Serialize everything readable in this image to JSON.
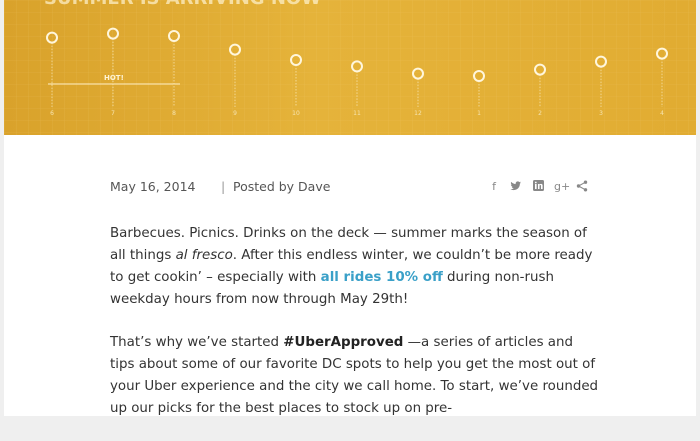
{
  "hero": {
    "title": "SUMMER IS ARRIVING NOW",
    "hot_label": "HOT!",
    "times": [
      "6",
      "7",
      "8",
      "9",
      "10",
      "11",
      "12",
      "1",
      "2",
      "3",
      "4"
    ],
    "temps": [
      0.78,
      0.83,
      0.8,
      0.63,
      0.5,
      0.42,
      0.33,
      0.3,
      0.38,
      0.48,
      0.58
    ]
  },
  "post": {
    "date": "May 16, 2014",
    "separator": "|",
    "posted_by": "Posted by Dave",
    "share_icons": [
      "facebook-icon",
      "twitter-icon",
      "linkedin-icon",
      "google-plus-icon",
      "share-icon"
    ],
    "p1_a": "Barbecues. Picnics. Drinks on the deck — summer marks the season of all things ",
    "p1_italic": "al fresco",
    "p1_b": ". After this endless winter, we couldn’t be more ready to get cookin’ – especially with ",
    "p1_link": "all rides 10% off",
    "p1_c": " during non-rush weekday hours from now through May 29th!",
    "p2_a": "That’s why we’ve started ",
    "p2_tag": "#UberApproved",
    "p2_b": " —a series of articles and tips about some of our favorite DC spots to help you get the most out of your Uber experience and the city we call home. To start, we’ve rounded up our picks for the best places to stock up on pre-"
  },
  "colors": {
    "accent": "#3aa0c8",
    "hero": "#e0aa33"
  }
}
